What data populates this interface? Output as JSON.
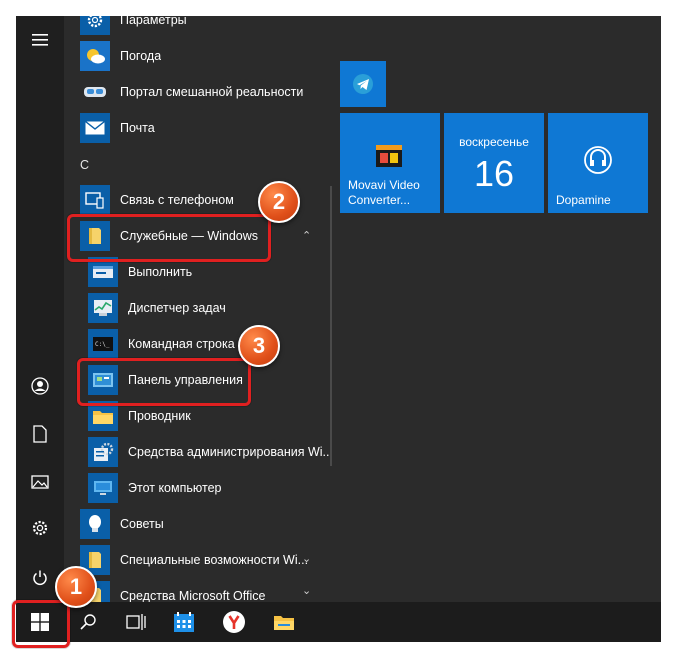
{
  "start_menu": {
    "apps": [
      {
        "label": "Параметры",
        "icon": "gear-icon"
      },
      {
        "label": "Погода",
        "icon": "weather-icon"
      },
      {
        "label": "Портал смешанной реальности",
        "icon": "mixed-reality-icon"
      },
      {
        "label": "Почта",
        "icon": "mail-icon"
      },
      {
        "label": "Связь с телефоном",
        "icon": "phone-link-icon"
      },
      {
        "label": "Служебные — Windows",
        "icon": "folder-icon"
      },
      {
        "label": "Выполнить",
        "icon": "run-icon"
      },
      {
        "label": "Диспетчер задач",
        "icon": "task-manager-icon"
      },
      {
        "label": "Командная строка",
        "icon": "cmd-icon"
      },
      {
        "label": "Панель управления",
        "icon": "control-panel-icon"
      },
      {
        "label": "Проводник",
        "icon": "explorer-icon"
      },
      {
        "label": "Средства администрирования Wi...",
        "icon": "admin-tools-icon"
      },
      {
        "label": "Этот компьютер",
        "icon": "this-pc-icon"
      },
      {
        "label": "Советы",
        "icon": "tips-icon"
      },
      {
        "label": "Специальные возможности Wi...",
        "icon": "folder-icon"
      },
      {
        "label": "Средства Microsoft Office",
        "icon": "folder-icon"
      }
    ],
    "section_letter": "С"
  },
  "tiles": {
    "movavi": "Movavi Video Converter...",
    "calendar_day": "воскресенье",
    "calendar_date": "16",
    "dopamine": "Dopamine"
  },
  "steps": {
    "one": "1",
    "two": "2",
    "three": "3"
  },
  "colors": {
    "tile": "#0f78d4",
    "highlight": "#e02020",
    "badge": "#e0501a"
  }
}
